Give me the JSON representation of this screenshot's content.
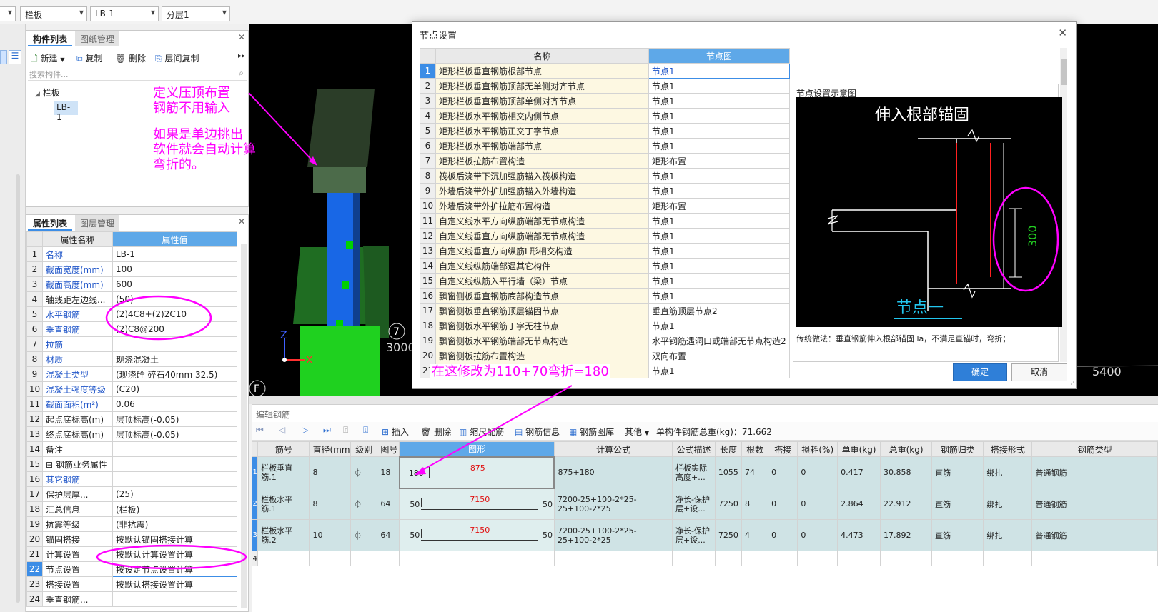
{
  "top_bar": {
    "combo1": "栏板",
    "combo2": "LB-1",
    "combo3": "分层1"
  },
  "component_panel": {
    "tabs": [
      "构件列表",
      "图纸管理"
    ],
    "toolbar": [
      "新建",
      "复制",
      "删除",
      "层间复制"
    ],
    "search_placeholder": "搜索构件...",
    "tree_root": "栏板",
    "tree_child": "LB-1"
  },
  "property_panel": {
    "tabs": [
      "属性列表",
      "图层管理"
    ],
    "col_name": "属性名称",
    "col_value": "属性值",
    "rows": [
      {
        "no": "1",
        "name": "名称",
        "value": "LB-1",
        "blue": true
      },
      {
        "no": "2",
        "name": "截面宽度(mm)",
        "value": "100",
        "blue": true
      },
      {
        "no": "3",
        "name": "截面高度(mm)",
        "value": "600",
        "blue": true
      },
      {
        "no": "4",
        "name": "轴线距左边线...",
        "value": "(50)",
        "blue": false
      },
      {
        "no": "5",
        "name": "水平钢筋",
        "value": "(2)4C8+(2)2C10",
        "blue": true
      },
      {
        "no": "6",
        "name": "垂直钢筋",
        "value": "(2)C8@200",
        "blue": true
      },
      {
        "no": "7",
        "name": "拉筋",
        "value": "",
        "blue": true
      },
      {
        "no": "8",
        "name": "材质",
        "value": "现浇混凝土",
        "blue": true
      },
      {
        "no": "9",
        "name": "混凝土类型",
        "value": "(现浇砼 碎石40mm 32.5)",
        "blue": true
      },
      {
        "no": "10",
        "name": "混凝土强度等级",
        "value": "(C20)",
        "blue": true
      },
      {
        "no": "11",
        "name": "截面面积(m²)",
        "value": "0.06",
        "blue": true
      },
      {
        "no": "12",
        "name": "起点底标高(m)",
        "value": "层顶标高(-0.05)",
        "blue": false
      },
      {
        "no": "13",
        "name": "终点底标高(m)",
        "value": "层顶标高(-0.05)",
        "blue": false
      },
      {
        "no": "14",
        "name": "备注",
        "value": "",
        "blue": false
      },
      {
        "no": "15",
        "name": "⊟ 钢筋业务属性",
        "value": "",
        "blue": false
      },
      {
        "no": "16",
        "name": "其它钢筋",
        "value": "",
        "blue": true
      },
      {
        "no": "17",
        "name": "保护层厚...",
        "value": "(25)",
        "blue": false
      },
      {
        "no": "18",
        "name": "汇总信息",
        "value": "(栏板)",
        "blue": false
      },
      {
        "no": "19",
        "name": "抗震等级",
        "value": "(非抗震)",
        "blue": false
      },
      {
        "no": "20",
        "name": "锚固搭接",
        "value": "按默认锚固搭接计算",
        "blue": false
      },
      {
        "no": "21",
        "name": "计算设置",
        "value": "按默认计算设置计算",
        "blue": false
      },
      {
        "no": "22",
        "name": "节点设置",
        "value": "按设定节点设置计算",
        "blue": false
      },
      {
        "no": "23",
        "name": "搭接设置",
        "value": "按默认搭接设置计算",
        "blue": false
      },
      {
        "no": "24",
        "name": "垂直钢筋...",
        "value": "",
        "blue": false
      }
    ]
  },
  "viewport": {
    "axis_z": "Z",
    "axis_x": "X",
    "marker_7": "7",
    "marker_f": "F",
    "partial_dim": "3000",
    "dim_right": "5400"
  },
  "annotations": {
    "note1_line1": "定义压顶布置",
    "note1_line2": "钢筋不用输入",
    "note2_line1": "如果是单边挑出",
    "note2_line2": "软件就会自动计算",
    "note2_line3": "弯折的。",
    "note3": "在这修改为110+70弯折=180"
  },
  "dialog": {
    "title": "节点设置",
    "close": "✕",
    "col_name": "名称",
    "col_node": "节点图",
    "rows": [
      {
        "no": "1",
        "name": "矩形栏板垂直钢筋根部节点",
        "node": "节点1"
      },
      {
        "no": "2",
        "name": "矩形栏板垂直钢筋顶部无单侧对齐节点",
        "node": "节点1"
      },
      {
        "no": "3",
        "name": "矩形栏板垂直钢筋顶部单侧对齐节点",
        "node": "节点1"
      },
      {
        "no": "4",
        "name": "矩形栏板水平钢筋相交内侧节点",
        "node": "节点1"
      },
      {
        "no": "5",
        "name": "矩形栏板水平钢筋正交丁字节点",
        "node": "节点1"
      },
      {
        "no": "6",
        "name": "矩形栏板水平钢筋端部节点",
        "node": "节点1"
      },
      {
        "no": "7",
        "name": "矩形栏板拉筋布置构造",
        "node": "矩形布置"
      },
      {
        "no": "8",
        "name": "筏板后浇带下沉加强筋锚入筏板构造",
        "node": "节点1"
      },
      {
        "no": "9",
        "name": "外墙后浇带外扩加强筋锚入外墙构造",
        "node": "节点1"
      },
      {
        "no": "10",
        "name": "外墙后浇带外扩拉筋布置构造",
        "node": "矩形布置"
      },
      {
        "no": "11",
        "name": "自定义线水平方向纵筋端部无节点构造",
        "node": "节点1"
      },
      {
        "no": "12",
        "name": "自定义线垂直方向纵筋端部无节点构造",
        "node": "节点1"
      },
      {
        "no": "13",
        "name": "自定义线垂直方向纵筋L形相交构造",
        "node": "节点1"
      },
      {
        "no": "14",
        "name": "自定义线纵筋端部遇其它构件",
        "node": "节点1"
      },
      {
        "no": "15",
        "name": "自定义线纵筋入平行墙（梁）节点",
        "node": "节点1"
      },
      {
        "no": "16",
        "name": "飘窗侧板垂直钢筋底部构造节点",
        "node": "节点1"
      },
      {
        "no": "17",
        "name": "飘窗侧板垂直钢筋顶层锚固节点",
        "node": "垂直筋顶层节点2"
      },
      {
        "no": "18",
        "name": "飘窗侧板水平钢筋丁字无柱节点",
        "node": "节点1"
      },
      {
        "no": "19",
        "name": "飘窗侧板水平钢筋端部无节点构造",
        "node": "水平钢筋遇洞口或端部无节点构造2"
      },
      {
        "no": "20",
        "name": "飘窗侧板拉筋布置构造",
        "node": "双向布置"
      },
      {
        "no": "21",
        "name": "飘窗顶板钢筋与支座上铁...",
        "node": "节点1"
      }
    ],
    "preview_label": "节点设置示意图",
    "preview_title": "伸入根部锚固",
    "preview_dim": "300",
    "preview_node": "节点一",
    "description": "传统做法：垂直钢筋伸入根部锚固 la，不满足直锚时，弯折；",
    "ok": "确定",
    "cancel": "取消"
  },
  "editor": {
    "title": "编辑钢筋",
    "toolbar": [
      "插入",
      "删除",
      "缩尺配筋",
      "钢筋信息",
      "钢筋图库",
      "其他"
    ],
    "total_weight": "单构件钢筋总重(kg)：71.662",
    "columns": [
      "筋号",
      "直径(mm)",
      "级别",
      "图号",
      "图形",
      "计算公式",
      "公式描述",
      "长度",
      "根数",
      "搭接",
      "损耗(%)",
      "单重(kg)",
      "总重(kg)",
      "钢筋归类",
      "搭接形式",
      "钢筋类型"
    ],
    "rows": [
      {
        "no": "1",
        "name": "栏板垂直筋.1",
        "dia": "8",
        "grade": "⏀",
        "fig": "18",
        "left": "180",
        "mid": "875",
        "right": "",
        "formula": "875+180",
        "desc": "栏板实际高度+...",
        "len": "1055",
        "count": "74",
        "lap": "0",
        "loss": "0",
        "unit": "0.417",
        "total": "30.858",
        "cls": "直筋",
        "lapform": "绑扎",
        "type": "普通钢筋"
      },
      {
        "no": "2",
        "name": "栏板水平筋.1",
        "dia": "8",
        "grade": "⏀",
        "fig": "64",
        "left": "50",
        "mid": "7150",
        "right": "50",
        "formula": "7200-25+100-2*25-25+100-2*25",
        "desc": "净长-保护层+设...",
        "len": "7250",
        "count": "8",
        "lap": "0",
        "loss": "0",
        "unit": "2.864",
        "total": "22.912",
        "cls": "直筋",
        "lapform": "绑扎",
        "type": "普通钢筋"
      },
      {
        "no": "3",
        "name": "栏板水平筋.2",
        "dia": "10",
        "grade": "⏀",
        "fig": "64",
        "left": "50",
        "mid": "7150",
        "right": "50",
        "formula": "7200-25+100-2*25-25+100-2*25",
        "desc": "净长-保护层+设...",
        "len": "7250",
        "count": "4",
        "lap": "0",
        "loss": "0",
        "unit": "4.473",
        "total": "17.892",
        "cls": "直筋",
        "lapform": "绑扎",
        "type": "普通钢筋"
      }
    ],
    "empty_row_no": "4"
  }
}
